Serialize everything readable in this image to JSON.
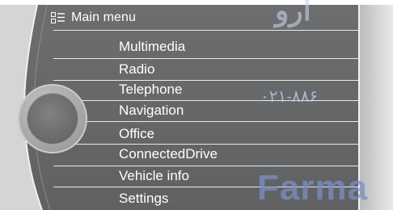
{
  "header": {
    "title": "Main menu",
    "icon": "main-menu-icon"
  },
  "menu": {
    "items": [
      {
        "label": "Multimedia"
      },
      {
        "label": "Radio"
      },
      {
        "label": "Telephone"
      },
      {
        "label": "Navigation"
      },
      {
        "label": "Office"
      },
      {
        "label": "ConnectedDrive"
      },
      {
        "label": "Vehicle info"
      },
      {
        "label": "Settings"
      }
    ]
  },
  "watermark": {
    "phone": "۰۲۱-۸۸۶",
    "brand": "Farma",
    "top": "ارو"
  },
  "colors": {
    "screen_bg": "#666869",
    "text": "#ffffff",
    "divider": "#e9e9e9",
    "watermark": "#7d8ec4"
  }
}
